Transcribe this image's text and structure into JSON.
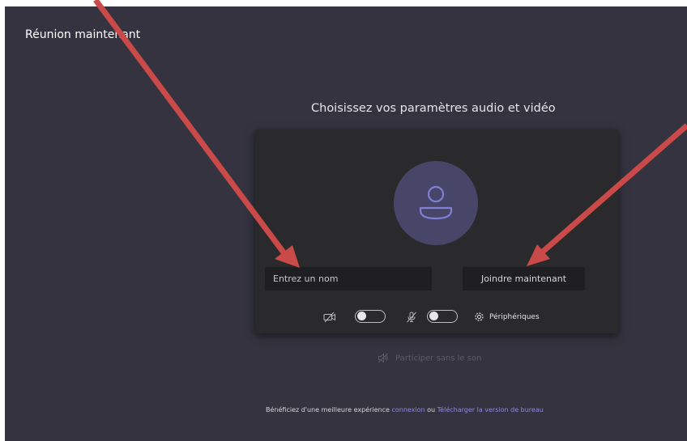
{
  "window": {
    "title": "Réunion maintenant"
  },
  "main": {
    "heading": "Choisissez vos paramètres audio et vidéo"
  },
  "preview": {
    "avatar_icon": "person-icon",
    "name_placeholder": "Entrez un nom",
    "join_label": "Joindre maintenant",
    "camera": {
      "icon": "camera-off-icon",
      "enabled": false
    },
    "microphone": {
      "icon": "mic-off-icon",
      "enabled": false
    },
    "devices_label": "Périphériques",
    "devices_icon": "gear-icon"
  },
  "no_audio": {
    "label": "Participer sans le son",
    "icon": "speaker-off-icon"
  },
  "footer": {
    "prefix": "Bénéficiez d'une meilleure expérience",
    "link_signin": "connexion",
    "middle": "ou",
    "link_download": "Télécharger la version de bureau"
  },
  "colors": {
    "background": "#34333f",
    "card": "#2a2a2c",
    "avatar": "#484668",
    "accent": "#7f7fd6",
    "arrow": "#c94a48"
  }
}
